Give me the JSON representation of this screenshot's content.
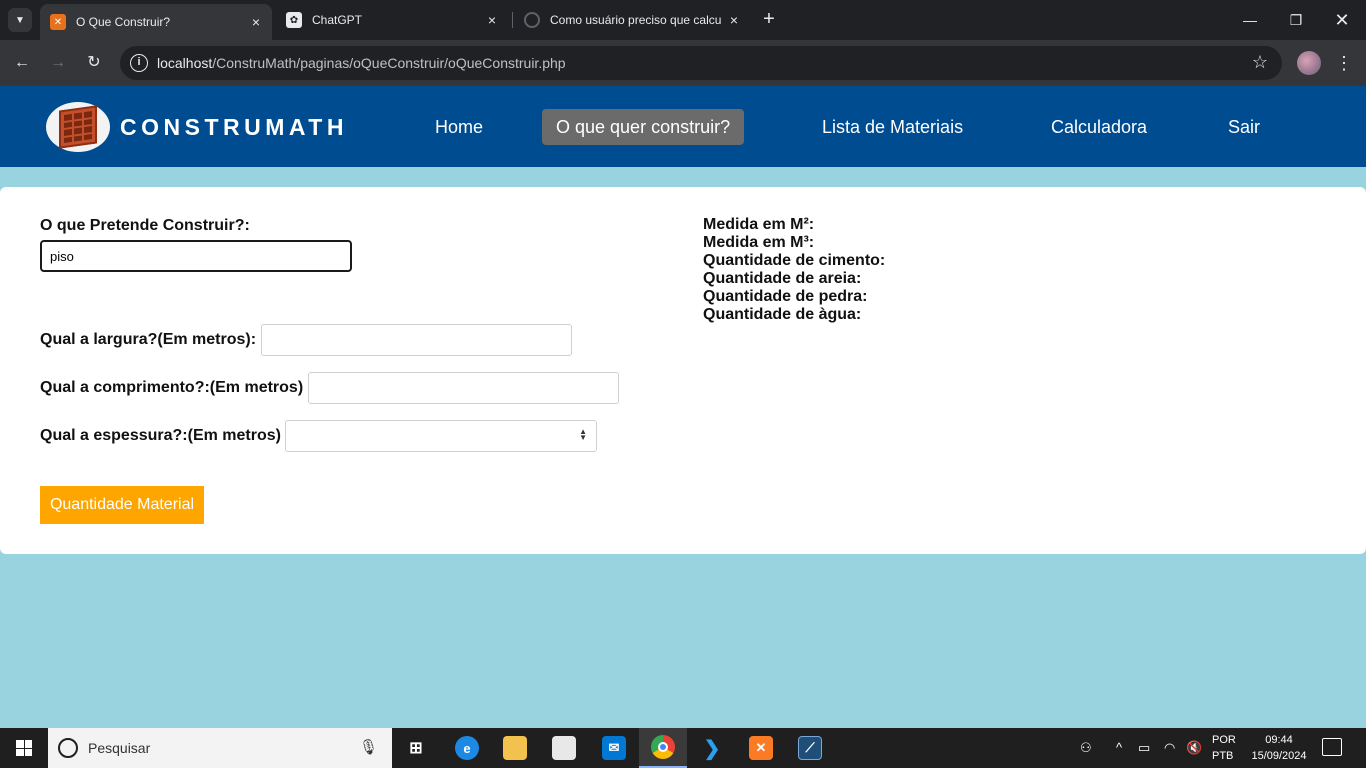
{
  "browser": {
    "tabs": [
      {
        "title": "O Que Construir?",
        "active": true
      },
      {
        "title": "ChatGPT",
        "active": false
      },
      {
        "title": "Como usuário preciso que calcu",
        "active": false
      }
    ],
    "close_glyph": "×",
    "new_tab_glyph": "+",
    "url_host": "localhost",
    "url_path": "/ConstruMath/paginas/oQueConstruir/oQueConstruir.php"
  },
  "site": {
    "brand": "CONSTRUMATH",
    "nav": [
      "Home",
      "O que quer construir?",
      "Lista de Materiais",
      "Calculadora",
      "Sair"
    ],
    "active_nav": "O que quer construir?",
    "nav_active_color": "#6b6b6b",
    "header_color": "#004c91"
  },
  "form": {
    "construir_label": "O que Pretende Construir?:",
    "construir_value": "piso",
    "largura_label": "Qual a largura?(Em metros):",
    "largura_value": "",
    "comprimento_label": "Qual a comprimento?:(Em metros)",
    "comprimento_value": "",
    "espessura_label": "Qual a espessura?:(Em metros)",
    "espessura_value": "",
    "submit_label": "Quantidade Material",
    "submit_color": "#ffa500"
  },
  "results": [
    "Medida em M²:",
    "Medida em M³:",
    "Quantidade de cimento:",
    "Quantidade de areia:",
    "Quantidade de pedra:",
    "Quantidade de àgua:"
  ],
  "taskbar": {
    "search_placeholder": "Pesquisar",
    "apps": [
      "task-view",
      "edge",
      "file-explorer",
      "store",
      "mail",
      "chrome",
      "vscode",
      "xampp",
      "mysql-workbench"
    ],
    "lang_line1": "POR",
    "lang_line2": "PTB",
    "time": "09:44",
    "date": "15/09/2024"
  },
  "page_background": "#99d3df"
}
